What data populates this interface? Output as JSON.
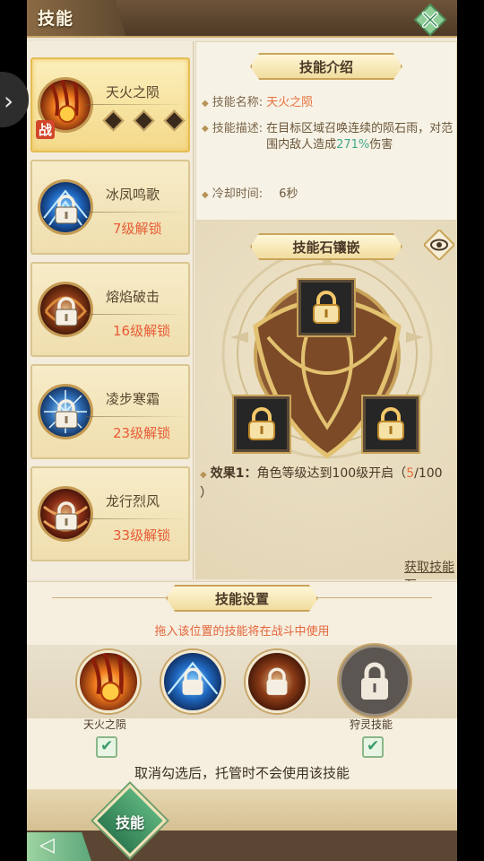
{
  "header": {
    "title": "技能"
  },
  "skills": [
    {
      "name": "天火之陨",
      "badge": "战",
      "unlock": ""
    },
    {
      "name": "冰凤鸣歌",
      "unlock": "7级解锁"
    },
    {
      "name": "熔焰破击",
      "unlock": "16级解锁"
    },
    {
      "name": "凌步寒霜",
      "unlock": "23级解锁"
    },
    {
      "name": "龙行烈风",
      "unlock": "33级解锁"
    }
  ],
  "intro": {
    "title": "技能介绍",
    "name_label": "技能名称:",
    "name_value": "天火之陨",
    "desc_label": "技能描述:",
    "desc_part1": "在目标区域召唤连续的陨石雨",
    "desc_part2": "，对范围内敌人造成",
    "desc_pct": "271%",
    "desc_part3": "伤害",
    "cd_label": "冷却时间:",
    "cd_value": "6秒"
  },
  "stone": {
    "title": "技能石镶嵌",
    "effect_label": "效果1：",
    "effect_text": "角色等级达到100级开启（",
    "effect_progress": "5",
    "effect_total": "/100",
    "effect_close": "）",
    "get_link": "获取技能石"
  },
  "settings": {
    "title": "技能设置",
    "hint": "拖入该位置的技能将在战斗中使用",
    "slot1_label": "天火之陨",
    "slot4_label": "狩灵技能",
    "note": "取消勾选后，托管时不会使用该技能"
  },
  "nav": {
    "skill_label": "技能"
  },
  "icons": {
    "close": "close-x-icon",
    "back": "back-arrow-icon",
    "eye": "eye-icon",
    "lock": "lock-icon",
    "check": "check-icon",
    "diamond": "diamond-icon"
  },
  "colors": {
    "accent_red": "#e85b35",
    "accent_green": "#41a98a",
    "gold": "#c9a45a"
  }
}
